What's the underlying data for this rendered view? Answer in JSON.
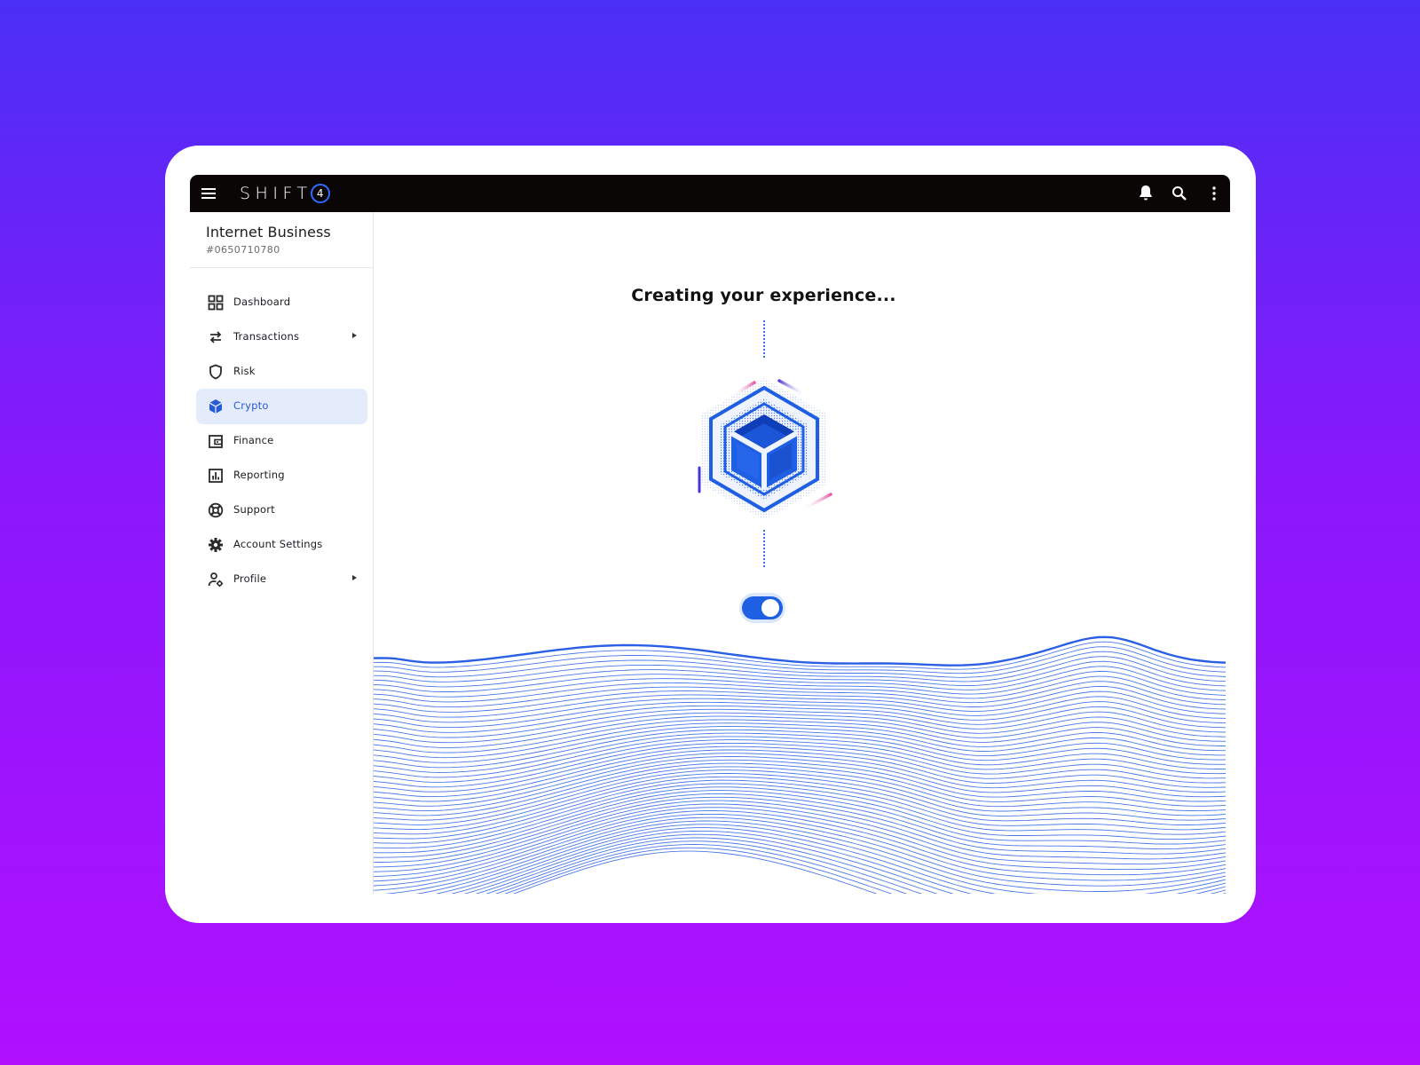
{
  "app": {
    "logo_text": "SHIFT",
    "logo_digit": "4"
  },
  "business": {
    "name": "Internet Business",
    "id": "#0650710780"
  },
  "sidebar": {
    "items": [
      {
        "label": "Dashboard",
        "icon": "grid-icon",
        "active": false,
        "has_submenu": false
      },
      {
        "label": "Transactions",
        "icon": "swap-arrows-icon",
        "active": false,
        "has_submenu": true
      },
      {
        "label": "Risk",
        "icon": "shield-icon",
        "active": false,
        "has_submenu": false
      },
      {
        "label": "Crypto",
        "icon": "cube-icon",
        "active": true,
        "has_submenu": false
      },
      {
        "label": "Finance",
        "icon": "wallet-icon",
        "active": false,
        "has_submenu": false
      },
      {
        "label": "Reporting",
        "icon": "bar-chart-icon",
        "active": false,
        "has_submenu": false
      },
      {
        "label": "Support",
        "icon": "lifebuoy-icon",
        "active": false,
        "has_submenu": false
      },
      {
        "label": "Account Settings",
        "icon": "gear-icon",
        "active": false,
        "has_submenu": false
      },
      {
        "label": "Profile",
        "icon": "user-settings-icon",
        "active": false,
        "has_submenu": true
      }
    ]
  },
  "main": {
    "headline": "Creating your experience...",
    "toggle_on": true
  },
  "colors": {
    "accent": "#1e5fe3",
    "topbar": "#0a0606",
    "active_bg": "#e4ecfb",
    "background_start": "#4a2ff5",
    "background_end": "#b010ff"
  }
}
